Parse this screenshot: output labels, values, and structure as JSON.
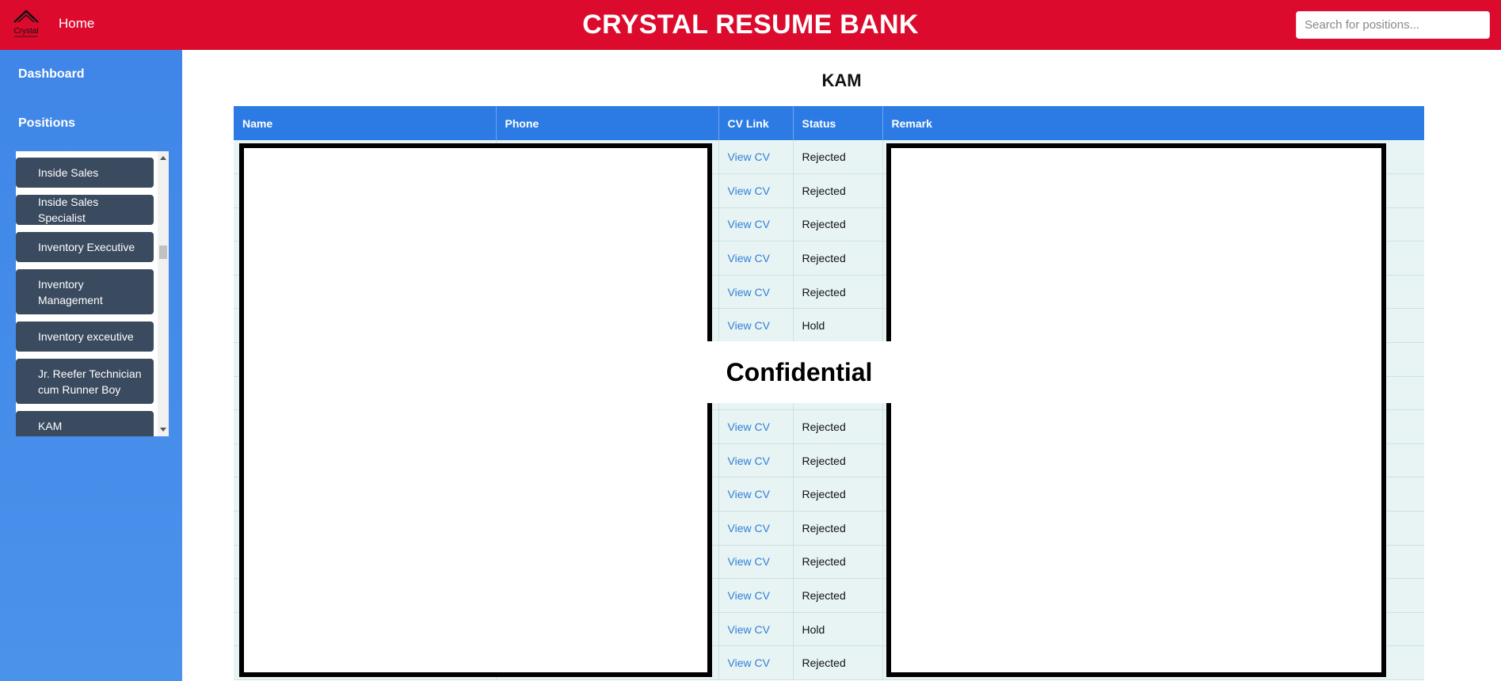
{
  "header": {
    "logo_text": "Crystal",
    "home_label": "Home",
    "title": "CRYSTAL RESUME BANK",
    "search_placeholder": "Search for positions..."
  },
  "sidebar": {
    "dashboard_label": "Dashboard",
    "positions_label": "Positions",
    "positions": [
      {
        "label": "Inside Sales"
      },
      {
        "label": "Inside Sales Specialist"
      },
      {
        "label": "Inventory Executive"
      },
      {
        "label": "Inventory Management"
      },
      {
        "label": "Inventory exceutive"
      },
      {
        "label": "Jr. Reefer Technician cum Runner Boy"
      },
      {
        "label": "KAM"
      }
    ]
  },
  "main": {
    "page_title": "KAM",
    "columns": [
      "Name",
      "Phone",
      "CV Link",
      "Status",
      "Remark"
    ],
    "rows": [
      {
        "cv_link": "View CV",
        "status": "Rejected"
      },
      {
        "cv_link": "View CV",
        "status": "Rejected"
      },
      {
        "cv_link": "View CV",
        "status": "Rejected"
      },
      {
        "cv_link": "View CV",
        "status": "Rejected"
      },
      {
        "cv_link": "View CV",
        "status": "Rejected"
      },
      {
        "cv_link": "View CV",
        "status": "Hold"
      },
      {
        "cv_link": "",
        "status": ""
      },
      {
        "cv_link": "",
        "status": ""
      },
      {
        "cv_link": "View CV",
        "status": "Rejected"
      },
      {
        "cv_link": "View CV",
        "status": "Rejected"
      },
      {
        "cv_link": "View CV",
        "status": "Rejected"
      },
      {
        "cv_link": "View CV",
        "status": "Rejected"
      },
      {
        "cv_link": "View CV",
        "status": "Rejected"
      },
      {
        "cv_link": "View CV",
        "status": "Rejected"
      },
      {
        "cv_link": "View CV",
        "status": "Hold"
      },
      {
        "cv_link": "View CV",
        "status": "Rejected"
      }
    ],
    "redaction_label": "Confidential"
  },
  "colors": {
    "header_bg": "#dc0a2d",
    "sidebar_bg": "#3f86e8",
    "table_header_bg": "#2c7be5",
    "table_row_bg": "#e8f4f4",
    "link_color": "#2f7fd8",
    "position_item_bg": "#3a4a5f"
  }
}
